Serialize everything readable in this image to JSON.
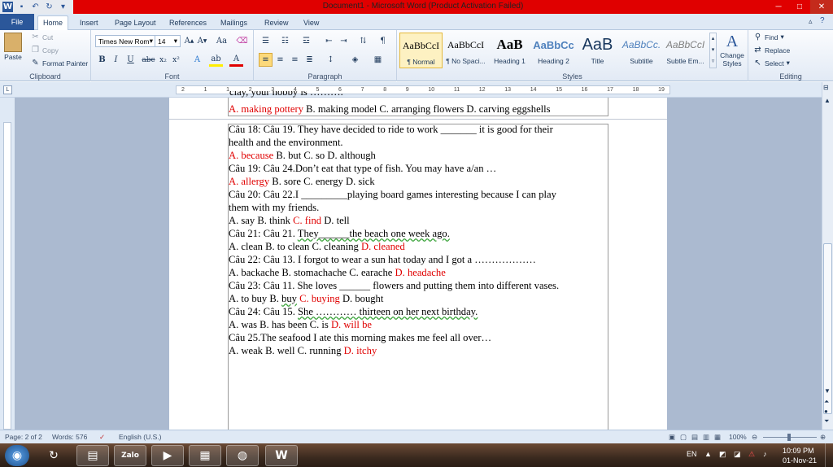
{
  "window": {
    "title": "Document1 - Microsoft Word (Product Activation Failed)",
    "controls": {
      "minimize": "─",
      "maximize": "□",
      "close": "✕"
    }
  },
  "ribbon_tabs": {
    "file": "File",
    "items": [
      "Home",
      "Insert",
      "Page Layout",
      "References",
      "Mailings",
      "Review",
      "View"
    ]
  },
  "clipboard": {
    "paste": "Paste",
    "cut": "Cut",
    "copy": "Copy",
    "format_painter": "Format Painter",
    "group": "Clipboard"
  },
  "font": {
    "name": "Times New Rom",
    "size": "14",
    "group": "Font"
  },
  "paragraph": {
    "group": "Paragraph"
  },
  "styles": {
    "items": [
      {
        "preview": "AaBbCcI",
        "name": "¶ Normal"
      },
      {
        "preview": "AaBbCcI",
        "name": "¶ No Spaci..."
      },
      {
        "preview": "AaB",
        "name": "Heading 1"
      },
      {
        "preview": "AaBbCc",
        "name": "Heading 2"
      },
      {
        "preview": "AaB",
        "name": "Title"
      },
      {
        "preview": "AaBbCc.",
        "name": "Subtitle"
      },
      {
        "preview": "AaBbCcI",
        "name": "Subtle Em..."
      }
    ],
    "change_styles": "Change Styles",
    "group": "Styles"
  },
  "editing": {
    "find": "Find",
    "replace": "Replace",
    "select": "Select",
    "group": "Editing"
  },
  "ruler": {
    "marks": [
      "2",
      "1",
      "1",
      "2",
      "3",
      "4",
      "5",
      "6",
      "7",
      "8",
      "9",
      "10",
      "11",
      "12",
      "13",
      "14",
      "15",
      "16",
      "17",
      "18",
      "19"
    ]
  },
  "document": {
    "cut_top": "clay, your hobby is ……….",
    "prev_options": [
      {
        "t": "A. making pottery",
        "red": true
      },
      {
        "t": " B. making model C. arranging flowers D. carving eggshells",
        "red": false
      }
    ],
    "lines": [
      [
        {
          "t": "Câu 18: Câu 19. They have decided to ride to work _______ it is good for their"
        }
      ],
      [
        {
          "t": "health and the environment."
        }
      ],
      [
        {
          "t": " A. because",
          "red": true
        },
        {
          "t": " B. but C. so D. although"
        }
      ],
      [
        {
          "t": "Câu 19: Câu 24.Don’t eat that type of fish. You may have a/an …"
        }
      ],
      [
        {
          "t": "A. allergy",
          "red": true
        },
        {
          "t": " B. sore C. energy D. sick"
        }
      ],
      [
        {
          "t": "Câu 20: Câu 22.I _________playing board games interesting because I can play"
        }
      ],
      [
        {
          "t": "them with my friends."
        }
      ],
      [
        {
          "t": " A. say B. think "
        },
        {
          "t": "C. find",
          "red": true
        },
        {
          "t": " D. tell"
        }
      ],
      [
        {
          "t": "Câu 21: Câu 21. "
        },
        {
          "t": "They______the beach one week ago.",
          "ul": true
        }
      ],
      [
        {
          "t": " A. clean B. to clean C. cleaning "
        },
        {
          "t": "D. cleaned",
          "red": true
        }
      ],
      [
        {
          "t": "Câu 22: Câu 13. I forgot to wear a sun hat today and I got a ………………"
        }
      ],
      [
        {
          "t": "A. backache B. stomachache C. earache "
        },
        {
          "t": "D. headache",
          "red": true
        }
      ],
      [
        {
          "t": "Câu 23: Câu 11. She loves ______ flowers and putting them into different vases."
        }
      ],
      [
        {
          "t": "A. to buy B. "
        },
        {
          "t": "buy",
          "ul": true
        },
        {
          "t": " "
        },
        {
          "t": "C. buying",
          "red": true
        },
        {
          "t": " D. bought"
        }
      ],
      [
        {
          "t": "Câu 24: Câu 15. "
        },
        {
          "t": "She ………… thirteen on her next birthday.",
          "ul": true
        }
      ],
      [
        {
          "t": " A. was B. has been C. is "
        },
        {
          "t": "D. will be",
          "red": true
        }
      ],
      [
        {
          "t": "Câu 25.The seafood I ate this morning makes me feel  all over…"
        }
      ],
      [
        {
          "t": "A. weak B. well C. running "
        },
        {
          "t": "D. itchy",
          "red": true
        }
      ]
    ]
  },
  "statusbar": {
    "page": "Page: 2 of 2",
    "words": "Words: 576",
    "language": "English (U.S.)",
    "zoom": "100%"
  },
  "taskbar": {
    "apps": [
      {
        "icon": "start-orb-icon",
        "glyph": "◉"
      },
      {
        "icon": "green-app-icon",
        "glyph": "↻"
      },
      {
        "icon": "file-explorer-icon",
        "glyph": "▤"
      },
      {
        "icon": "zalo-icon",
        "glyph": "Zalo"
      },
      {
        "icon": "media-player-icon",
        "glyph": "▶"
      },
      {
        "icon": "calculator-icon",
        "glyph": "▦"
      },
      {
        "icon": "chrome-icon",
        "glyph": "◍"
      },
      {
        "icon": "word-icon",
        "glyph": "W"
      }
    ],
    "language": "EN",
    "time": "10:09 PM",
    "date": "01-Nov-21"
  }
}
